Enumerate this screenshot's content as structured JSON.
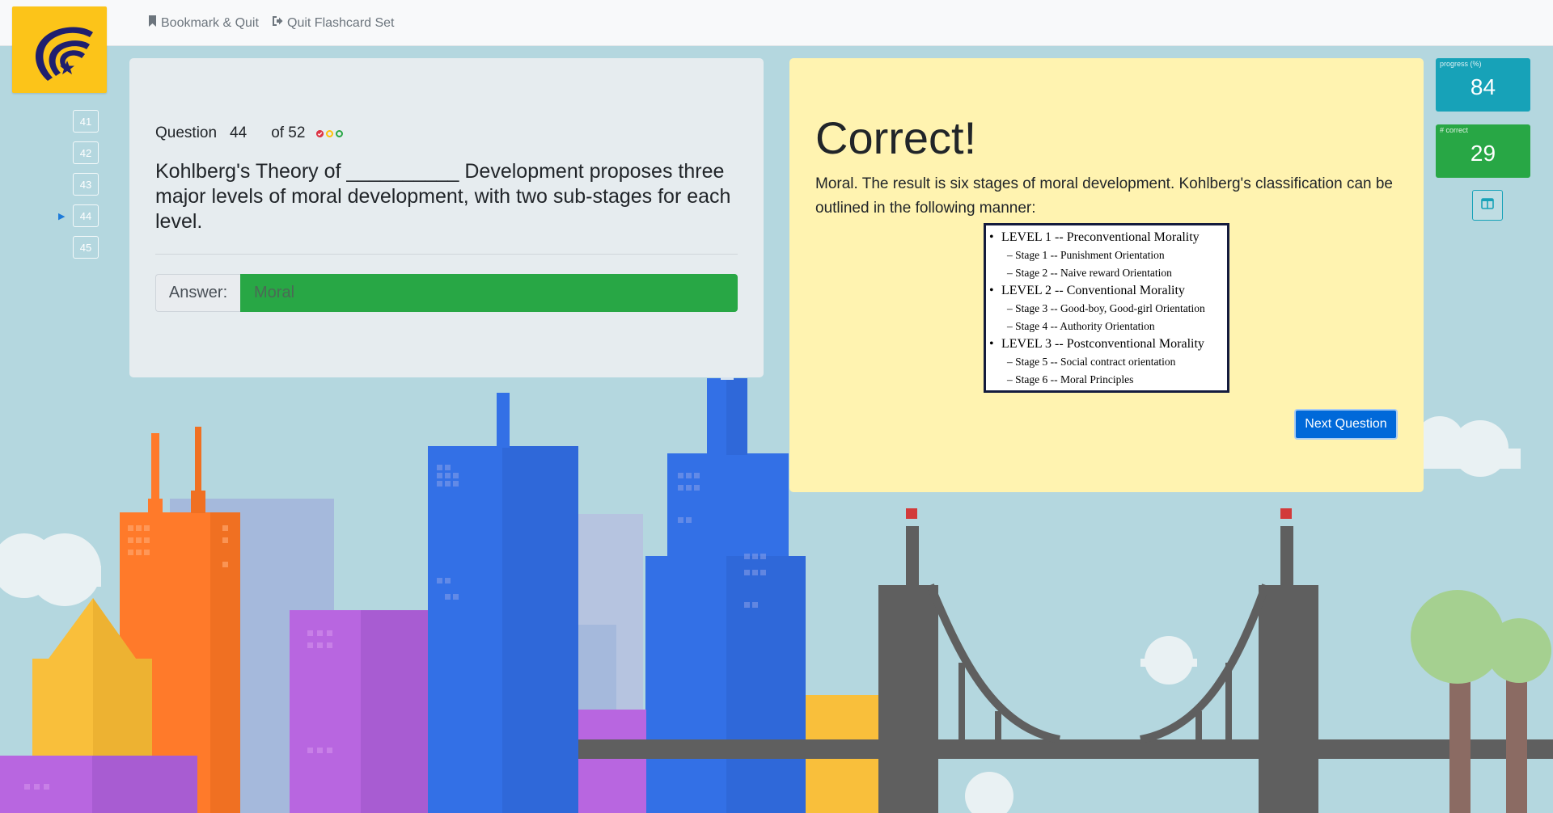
{
  "colors": {
    "logo_bg": "#fcc419",
    "correct_green": "#28a745",
    "result_bg": "#fff3b0",
    "primary_blue": "#0069d9",
    "progress_teal": "#17a2b8",
    "correct_stat_green": "#28a745"
  },
  "topbar": {
    "bookmark_label": "Bookmark & Quit",
    "bookmark_icon": "bookmark-icon",
    "quit_label": "Quit Flashcard Set",
    "quit_icon": "sign-out-icon"
  },
  "question_nav": {
    "items": [
      "41",
      "42",
      "43",
      "44",
      "45"
    ],
    "current": "44",
    "current_indicator": "▶"
  },
  "question": {
    "label": "Question",
    "number": "44",
    "of_text": "of 52",
    "status_dots": [
      {
        "icon": "check-circle-icon",
        "color": "#dc3545"
      },
      {
        "icon": "circle-icon",
        "color": "#ffc107"
      },
      {
        "icon": "circle-icon",
        "color": "#28a745"
      }
    ],
    "text": "Kohlberg's Theory of __________ Development proposes three major levels of moral development, with two sub-stages for each level.",
    "answer_label": "Answer:",
    "answer_value": "Moral"
  },
  "result": {
    "title": "Correct!",
    "explanation": "Moral. The result is six stages of moral development. Kohlberg's classification can be outlined in the following manner:",
    "image_levels": [
      {
        "label": "LEVEL 1 --  Preconventional Morality",
        "stages": [
          "Stage 1 --  Punishment Orientation",
          "Stage 2 --  Naive reward Orientation"
        ]
      },
      {
        "label": "LEVEL 2 --  Conventional Morality",
        "stages": [
          "Stage 3 --  Good-boy, Good-girl Orientation",
          "Stage 4 --  Authority Orientation"
        ]
      },
      {
        "label": "LEVEL 3 --  Postconventional Morality",
        "stages": [
          "Stage 5 --  Social contract orientation",
          "Stage 6 --  Moral Principles"
        ]
      }
    ],
    "next_button": "Next Question"
  },
  "stats": {
    "progress_label": "progress (%)",
    "progress_value": "84",
    "correct_label": "# correct",
    "correct_value": "29",
    "layout_icon": "columns-icon"
  }
}
